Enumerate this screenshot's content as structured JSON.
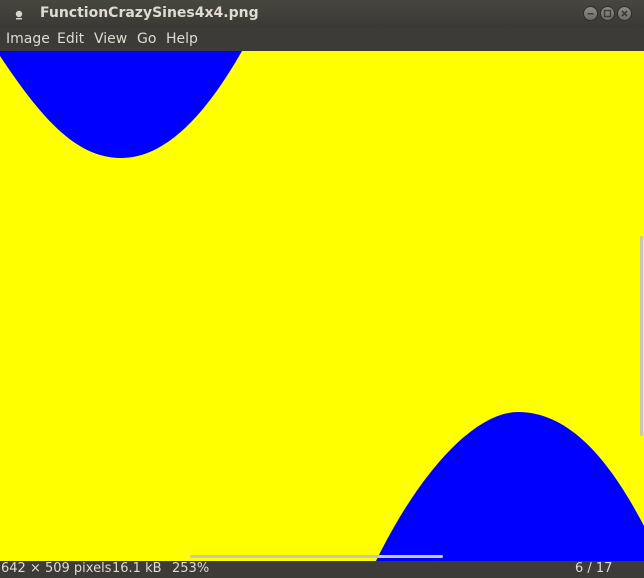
{
  "window": {
    "title": "FunctionCrazySines4x4.png"
  },
  "menu": {
    "items": [
      "Image",
      "Edit",
      "View",
      "Go",
      "Help"
    ]
  },
  "image": {
    "background_color": "#ffff00",
    "shape_color": "#0000ff"
  },
  "status": {
    "dimensions": "642 × 509 pixels",
    "size": "16.1 kB",
    "zoom": "253%",
    "position": "6 / 17"
  },
  "icons": {
    "app": "eye-of-gnome-icon",
    "minimize": "minimize-icon",
    "maximize": "maximize-icon",
    "close": "close-icon"
  }
}
